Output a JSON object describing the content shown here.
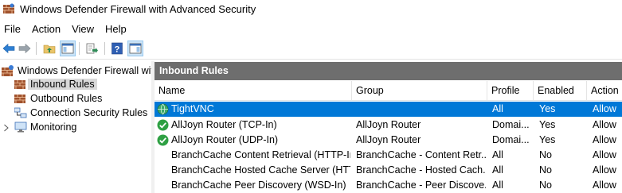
{
  "window": {
    "title": "Windows Defender Firewall with Advanced Security"
  },
  "menu": [
    "File",
    "Action",
    "View",
    "Help"
  ],
  "toolbar": {
    "buttons": [
      "back-icon",
      "forward-icon",
      "up-folder-icon",
      "show-hide-console-tree-icon",
      "export-list-icon",
      "help-icon",
      "show-hide-action-pane-icon"
    ]
  },
  "tree": {
    "root": "Windows Defender Firewall with Advanced Security",
    "items": [
      "Inbound Rules",
      "Outbound Rules",
      "Connection Security Rules",
      "Monitoring"
    ],
    "selected": "Inbound Rules"
  },
  "pane": {
    "header": "Inbound Rules",
    "columns": [
      "Name",
      "Group",
      "Profile",
      "Enabled",
      "Action"
    ],
    "rows": [
      {
        "name": "TightVNC",
        "group": "",
        "profile": "All",
        "enabled": "Yes",
        "action": "Allow",
        "icon": "globe-shield-icon",
        "selected": true
      },
      {
        "name": "AllJoyn Router (TCP-In)",
        "group": "AllJoyn Router",
        "profile": "Domai...",
        "enabled": "Yes",
        "action": "Allow",
        "icon": "enabled-check-icon",
        "selected": false
      },
      {
        "name": "AllJoyn Router (UDP-In)",
        "group": "AllJoyn Router",
        "profile": "Domai...",
        "enabled": "Yes",
        "action": "Allow",
        "icon": "enabled-check-icon",
        "selected": false
      },
      {
        "name": "BranchCache Content Retrieval (HTTP-In)",
        "group": "BranchCache - Content Retr...",
        "profile": "All",
        "enabled": "No",
        "action": "Allow",
        "icon": "",
        "selected": false
      },
      {
        "name": "BranchCache Hosted Cache Server (HTTP...",
        "group": "BranchCache - Hosted Cach...",
        "profile": "All",
        "enabled": "No",
        "action": "Allow",
        "icon": "",
        "selected": false
      },
      {
        "name": "BranchCache Peer Discovery (WSD-In)",
        "group": "BranchCache - Peer Discove...",
        "profile": "All",
        "enabled": "No",
        "action": "Allow",
        "icon": "",
        "selected": false
      }
    ]
  },
  "colors": {
    "selection": "#0078d7",
    "pane_header": "#6e6e6e",
    "enabled_green": "#2ea043"
  }
}
